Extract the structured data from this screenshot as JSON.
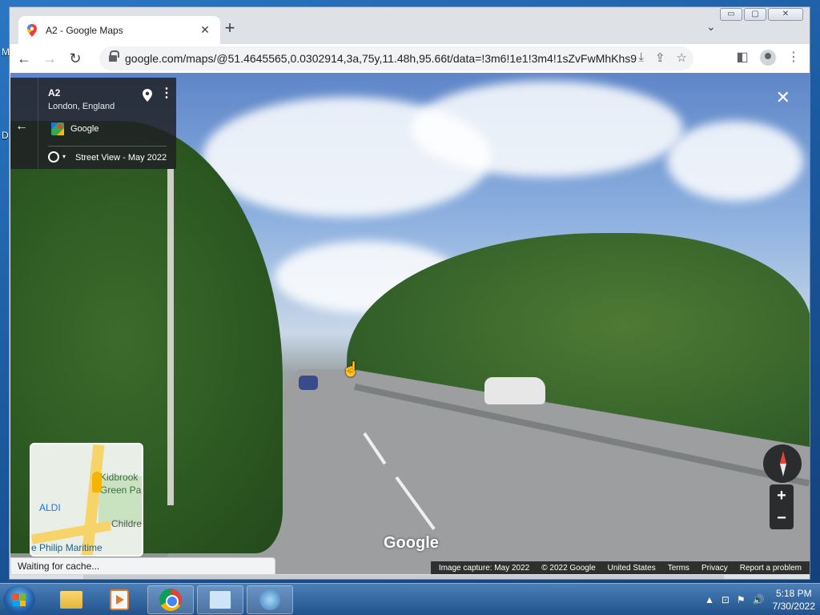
{
  "desktop": {
    "letters": [
      "M",
      "D"
    ]
  },
  "browser": {
    "tab_title": "A2 - Google Maps",
    "tab_close": "✕",
    "new_tab": "+",
    "tab_list": "⌄",
    "window_controls": {
      "minimize": "▭",
      "maximize": "▢",
      "close": "✕"
    },
    "url": "google.com/maps/@51.4645565,0.0302914,3a,75y,11.48h,95.66t/data=!3m6!1e1!3m4!1sZvFwMhKhs9...",
    "nav": {
      "back": "←",
      "forward": "→",
      "reload": "↻"
    },
    "omni_icons": {
      "install": "⤓",
      "share": "⇪",
      "bookmark": "☆"
    },
    "side_panel": "◧",
    "menu": "⋮",
    "status": "Waiting for cache..."
  },
  "street_view": {
    "place_title": "A2",
    "place_subtitle": "London, England",
    "back_arrow": "←",
    "more": "⋮",
    "source": "Google",
    "date_label": "Street View - May 2022",
    "close": "✕",
    "watermark": "Google",
    "zoom_in": "+",
    "zoom_out": "−",
    "minimap": {
      "labels": [
        "Kidbrook",
        "Green Pa",
        "ALDI",
        "Childre",
        "e Philip Maritime"
      ]
    },
    "attribution": [
      "Image capture: May 2022",
      "© 2022 Google",
      "United States",
      "Terms",
      "Privacy",
      "Report a problem"
    ]
  },
  "taskbar": {
    "clock_time": "5:18 PM",
    "clock_date": "7/30/2022",
    "tray": {
      "show_hidden": "▲",
      "network": "⊡",
      "flag": "⚑",
      "volume": "🔊"
    }
  }
}
